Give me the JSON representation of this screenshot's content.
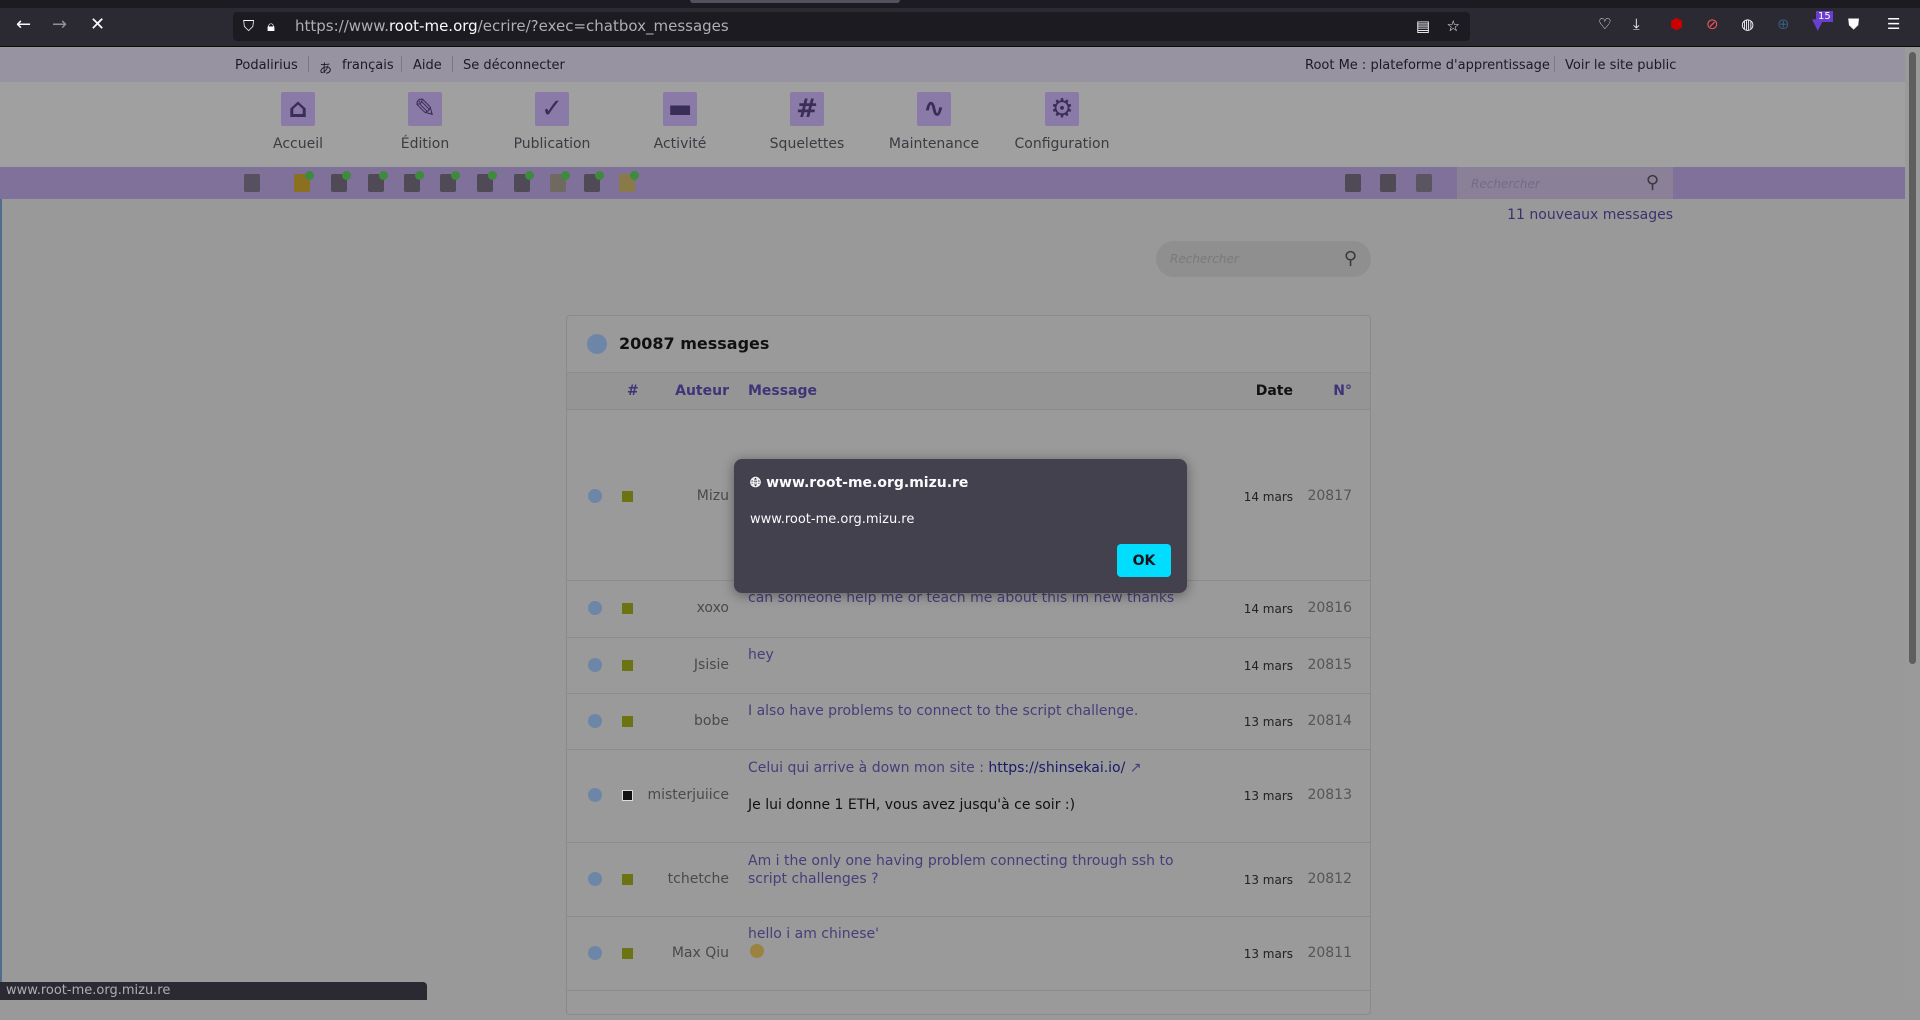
{
  "browser": {
    "url_prefix": "https://www.",
    "url_domain": "root-me.org",
    "url_path": "/ecrire/?exec=chatbox_messages",
    "extension_badge": "15",
    "status_url": "www.root-me.org.mizu.re"
  },
  "topbar": {
    "user": "Podalirius",
    "language": "français",
    "help": "Aide",
    "logout": "Se déconnecter",
    "site_name": "Root Me : plateforme d'apprentissage",
    "public_site": "Voir le site public"
  },
  "nav": [
    {
      "label": "Accueil",
      "icon": "home-icon"
    },
    {
      "label": "Édition",
      "icon": "edit-icon"
    },
    {
      "label": "Publication",
      "icon": "publish-check-icon"
    },
    {
      "label": "Activité",
      "icon": "chat-icon"
    },
    {
      "label": "Squelettes",
      "icon": "hash-icon"
    },
    {
      "label": "Maintenance",
      "icon": "pulse-icon"
    },
    {
      "label": "Configuration",
      "icon": "gear-icon"
    }
  ],
  "toolbar": {
    "search_placeholder": "Rechercher",
    "new_messages": "11 nouveaux messages"
  },
  "content": {
    "search_placeholder": "Rechercher",
    "title": "20087 messages"
  },
  "table": {
    "headers": {
      "hash": "#",
      "author": "Auteur",
      "message": "Message",
      "date": "Date",
      "number": "N°"
    },
    "rows": [
      {
        "author": "Mizu",
        "message": "",
        "date": "14 mars",
        "number": "20817"
      },
      {
        "author": "xoxo",
        "message": "can someone help me or teach me about this im new thanks",
        "date": "14 mars",
        "number": "20816"
      },
      {
        "author": "Jsisie",
        "message": "hey",
        "date": "14 mars",
        "number": "20815"
      },
      {
        "author": "bobe",
        "message": "I also have problems to connect to the script challenge.",
        "date": "13 mars",
        "number": "20814"
      },
      {
        "author": "misterjuiice",
        "message": "Celui qui arrive à down mon site : ",
        "link": "https://shinsekai.io/",
        "link_arrow": "↗",
        "message2": "Je lui donne 1 ETH, vous avez jusqu'à ce soir :)",
        "date": "13 mars",
        "number": "20813"
      },
      {
        "author": "tchetche",
        "message": "Am i the only one having problem connecting through ssh to script challenges ?",
        "date": "13 mars",
        "number": "20812"
      },
      {
        "author": "Max Qiu",
        "message": "hello i am chinese'",
        "date": "13 mars",
        "number": "20811"
      }
    ]
  },
  "dialog": {
    "title": "www.root-me.org.mizu.re",
    "body": "www.root-me.org.mizu.re",
    "ok": "OK"
  },
  "colors": {
    "accent": "#00ddff",
    "purple_bar": "#7f7199",
    "link": "#473d7a",
    "status_flag": "#6b7312"
  }
}
